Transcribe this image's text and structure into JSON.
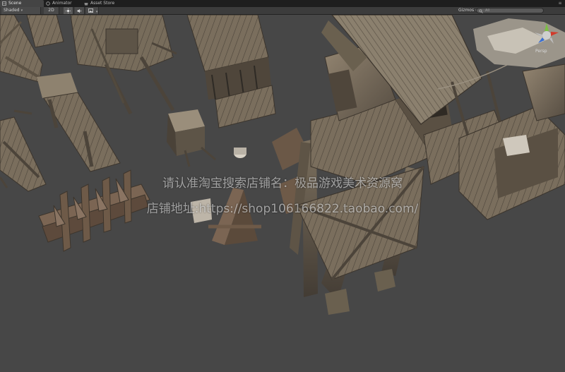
{
  "tabs": [
    {
      "label": "Scene",
      "icon": "scene-icon",
      "active": true
    },
    {
      "label": "Animator",
      "icon": "animator-icon",
      "active": false
    },
    {
      "label": "Asset Store",
      "icon": "store-icon",
      "active": false
    }
  ],
  "toolbar": {
    "shading_mode": "Shaded",
    "mode_2d": "2D",
    "lighting_icon": "sun-icon",
    "audio_icon": "speaker-icon",
    "effects_icon": "image-icon",
    "gizmos_label": "Gizmos",
    "search_placeholder": "All"
  },
  "scene": {
    "camera_mode": "Persp"
  },
  "watermark": {
    "line1": "请认准淘宝搜索店铺名：极品游戏美术资源窝",
    "line2": "店铺地址:https://shop106166822.taobao.com/"
  },
  "colors": {
    "tab_bg": "#1e1e1e",
    "toolbar_bg": "#3c3c3c",
    "viewport_bg": "#474747",
    "wood_light": "#8a7d6b",
    "wood_dark": "#4e463c",
    "gizmo_x": "#d23a2a",
    "gizmo_y": "#7bc043",
    "gizmo_z": "#3a6fd2"
  }
}
